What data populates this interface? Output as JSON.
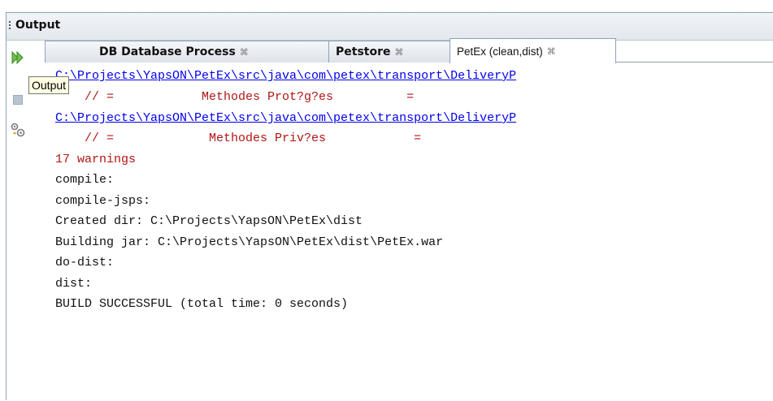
{
  "panel": {
    "title": "Output"
  },
  "tooltip": {
    "text": "Output"
  },
  "tabs": [
    {
      "label": "DB Database Process",
      "close": "⌘"
    },
    {
      "label": "Petstore",
      "close": "⌘"
    },
    {
      "label": "PetEx (clean,dist)",
      "close": "⌘"
    }
  ],
  "colors": {
    "link": "#0000ee",
    "warning": "#b21414",
    "text": "#111111",
    "border": "#8ea1b8"
  },
  "icons": [
    "grip-icon",
    "run-again-icon",
    "stop-icon",
    "settings-icon",
    "close-tab-icon"
  ],
  "console": {
    "lines": [
      {
        "kind": "link",
        "text": "C:\\Projects\\YapsON\\PetEx\\src\\java\\com\\petex\\transport\\DeliveryP"
      },
      {
        "kind": "red",
        "text": "    // =            Methodes Prot?g?es          ="
      },
      {
        "kind": "link",
        "text": "C:\\Projects\\YapsON\\PetEx\\src\\java\\com\\petex\\transport\\DeliveryP"
      },
      {
        "kind": "red",
        "text": "    // =             Methodes Priv?es            ="
      },
      {
        "kind": "red",
        "text": "17 warnings"
      },
      {
        "kind": "norm",
        "text": "compile:"
      },
      {
        "kind": "norm",
        "text": "compile-jsps:"
      },
      {
        "kind": "norm",
        "text": "Created dir: C:\\Projects\\YapsON\\PetEx\\dist"
      },
      {
        "kind": "norm",
        "text": "Building jar: C:\\Projects\\YapsON\\PetEx\\dist\\PetEx.war"
      },
      {
        "kind": "norm",
        "text": "do-dist:"
      },
      {
        "kind": "norm",
        "text": "dist:"
      },
      {
        "kind": "norm",
        "text": "BUILD SUCCESSFUL (total time: 0 seconds)"
      }
    ]
  }
}
